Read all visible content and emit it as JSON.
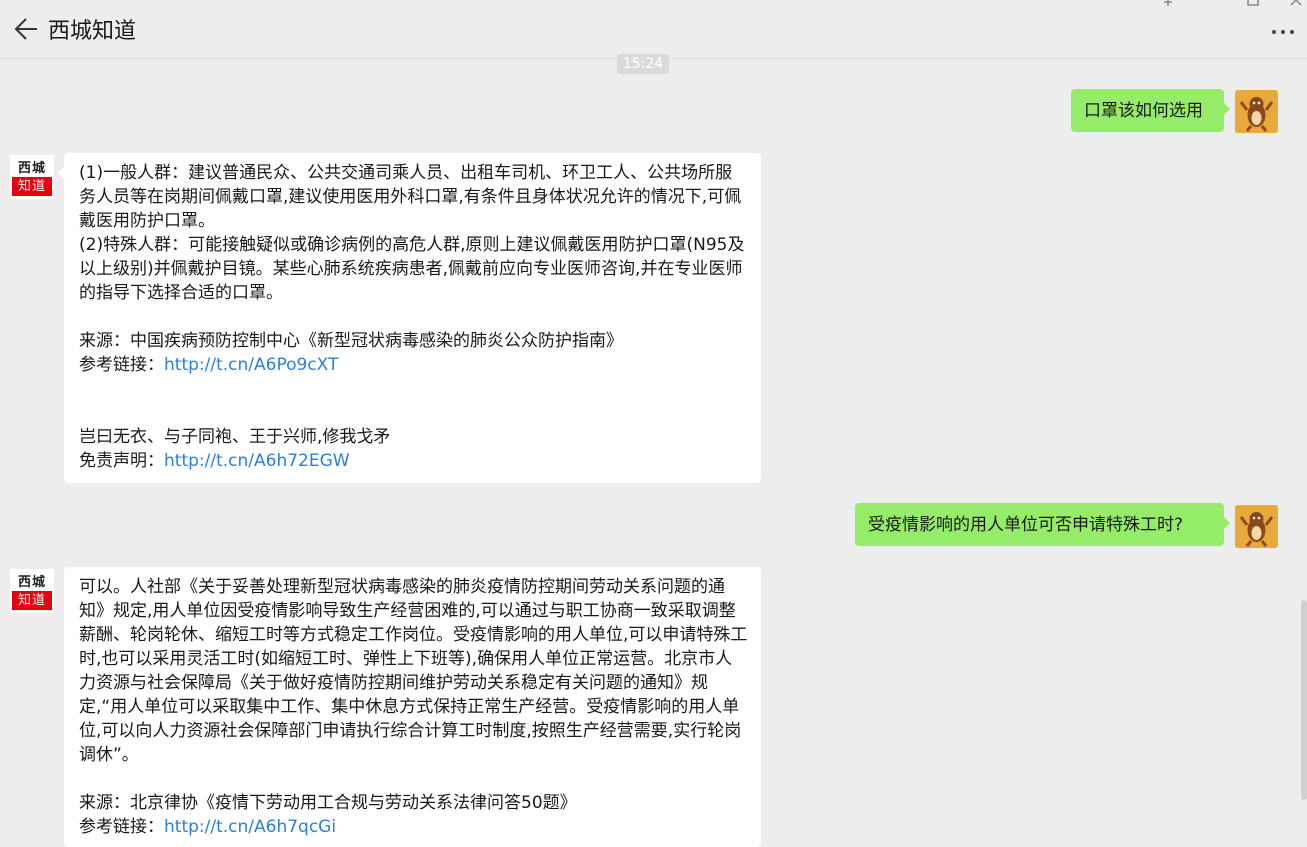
{
  "header": {
    "title": "西城知道"
  },
  "timestamp": "15:24",
  "bot": {
    "avatar_line1": "西城",
    "avatar_line2": "知道"
  },
  "messages": {
    "q1": "口罩该如何选用",
    "a1": {
      "p1": "(1)一般人群：建议普通民众、公共交通司乘人员、出租车司机、环卫工人、公共场所服务人员等在岗期间佩戴口罩,建议使用医用外科口罩,有条件且身体状况允许的情况下,可佩戴医用防护口罩。",
      "p2": "(2)特殊人群：可能接触疑似或确诊病例的高危人群,原则上建议佩戴医用防护口罩(N95及以上级别)并佩戴护目镜。某些心肺系统疾病患者,佩戴前应向专业医师咨询,并在专业医师的指导下选择合适的口罩。",
      "source": "来源：中国疾病预防控制中心《新型冠状病毒感染的肺炎公众防护指南》",
      "ref_label": "参考链接：",
      "ref_link": "http://t.cn/A6Po9cXT",
      "poem": "岂曰无衣、与子同袍、王于兴师,修我戈矛",
      "disclaimer_label": "免责声明：",
      "disclaimer_link": "http://t.cn/A6h72EGW"
    },
    "q2": "受疫情影响的用人单位可否申请特殊工时?",
    "a2": {
      "p1": "可以。人社部《关于妥善处理新型冠状病毒感染的肺炎疫情防控期间劳动关系问题的通知》规定,用人单位因受疫情影响导致生产经营困难的,可以通过与职工协商一致采取调整薪酬、轮岗轮休、缩短工时等方式稳定工作岗位。受疫情影响的用人单位,可以申请特殊工时,也可以采用灵活工时(如缩短工时、弹性上下班等),确保用人单位正常运营。北京市人力资源与社会保障局《关于做好疫情防控期间维护劳动关系稳定有关问题的通知》规定,“用人单位可以采取集中工作、集中休息方式保持正常生产经营。受疫情影响的用人单位,可以向人力资源社会保障部门申请执行综合计算工时制度,按照生产经营需要,实行轮岗调休”。",
      "source": "来源：北京律协《疫情下劳动用工合规与劳动关系法律问答50题》",
      "ref_label": "参考链接：",
      "ref_link": "http://t.cn/A6h7qcGi"
    }
  }
}
